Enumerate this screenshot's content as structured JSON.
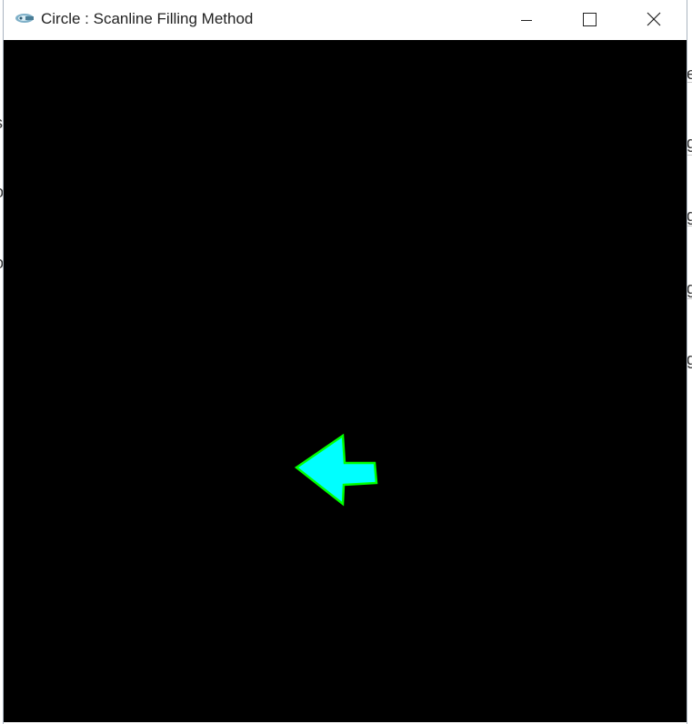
{
  "window": {
    "title": "Circle : Scanline Filling Method",
    "icon": "app-icon",
    "controls": {
      "minimize": "minimize-icon",
      "maximize": "maximize-icon",
      "close": "close-icon"
    }
  },
  "canvas": {
    "background": "#000000",
    "shape": {
      "kind": "left-arrow",
      "fill_color": "#00ffff",
      "outline_color": "#00ff00"
    }
  },
  "background_window": {
    "right_fragments": [
      "e",
      "g",
      "g",
      "g",
      "g"
    ],
    "left_fragments": [
      "s",
      "o",
      "o"
    ]
  },
  "colors": {
    "title_bar": "#ffffff",
    "title_text": "#222222",
    "fill": "#00ffff",
    "outline": "#00ff00"
  }
}
